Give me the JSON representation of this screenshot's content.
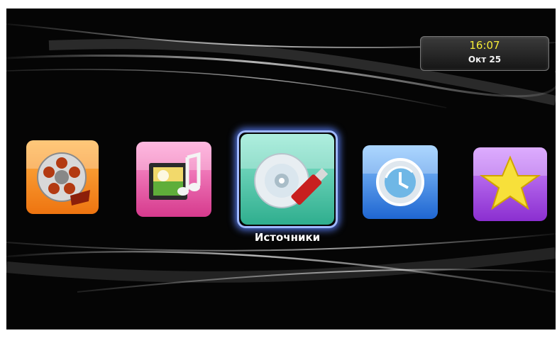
{
  "clock": {
    "time": "16:07",
    "date": "Окт 25"
  },
  "menu": {
    "selected_label": "Источники",
    "items": [
      {
        "id": "movies",
        "icon": "film-reel-icon",
        "color": "#f38a16"
      },
      {
        "id": "media",
        "icon": "music-film-icon",
        "color": "#e34a9a"
      },
      {
        "id": "sources",
        "icon": "disc-usb-icon",
        "color": "#4dcab0",
        "selected": true
      },
      {
        "id": "history",
        "icon": "clock-history-icon",
        "color": "#2f7fe0"
      },
      {
        "id": "favorites",
        "icon": "star-icon",
        "color": "#9a3bd8"
      }
    ]
  },
  "colors": {
    "background": "#050505",
    "clock_time": "#f6ec38",
    "selection": "#9fb8ff"
  }
}
